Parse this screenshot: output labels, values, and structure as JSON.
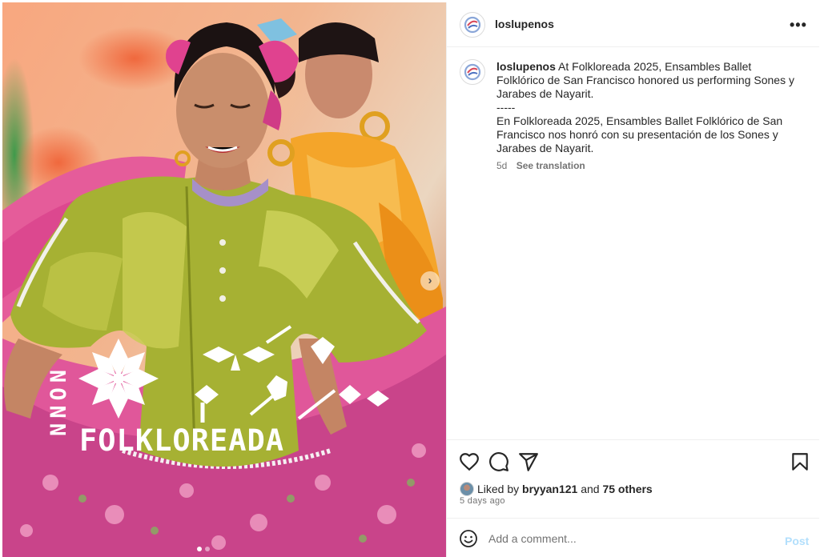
{
  "post": {
    "username": "loslupenos",
    "more_icon": "more-horizontal-icon",
    "media": {
      "overlay_vertical_text": "NNON",
      "overlay_title": "FOLKLOREADA",
      "next_icon": "chevron-right-icon",
      "carousel_dots": 2,
      "active_dot": 0
    },
    "caption": {
      "username": "loslupenos",
      "line1": "At Folkloreada 2025, Ensambles Ballet Folklórico de San Francisco honored us performing Sones y Jarabes de Nayarit.",
      "separator": "-----",
      "line2": "En Folkloreada 2025, Ensambles Ballet Folklórico de San Francisco nos honró con su presentación de los Sones y Jarabes de Nayarit.",
      "age": "5d",
      "translate": "See translation"
    },
    "actions": {
      "like_icon": "heart-icon",
      "comment_icon": "comment-icon",
      "share_icon": "send-icon",
      "save_icon": "bookmark-icon"
    },
    "likes": {
      "prefix": "Liked by",
      "user": "bryyan121",
      "joiner": "and",
      "others": "75 others"
    },
    "timestamp": "5 days ago",
    "comment": {
      "emoji_icon": "emoji-icon",
      "placeholder": "Add a comment...",
      "post_label": "Post",
      "post_color": "#b2dffc"
    }
  }
}
